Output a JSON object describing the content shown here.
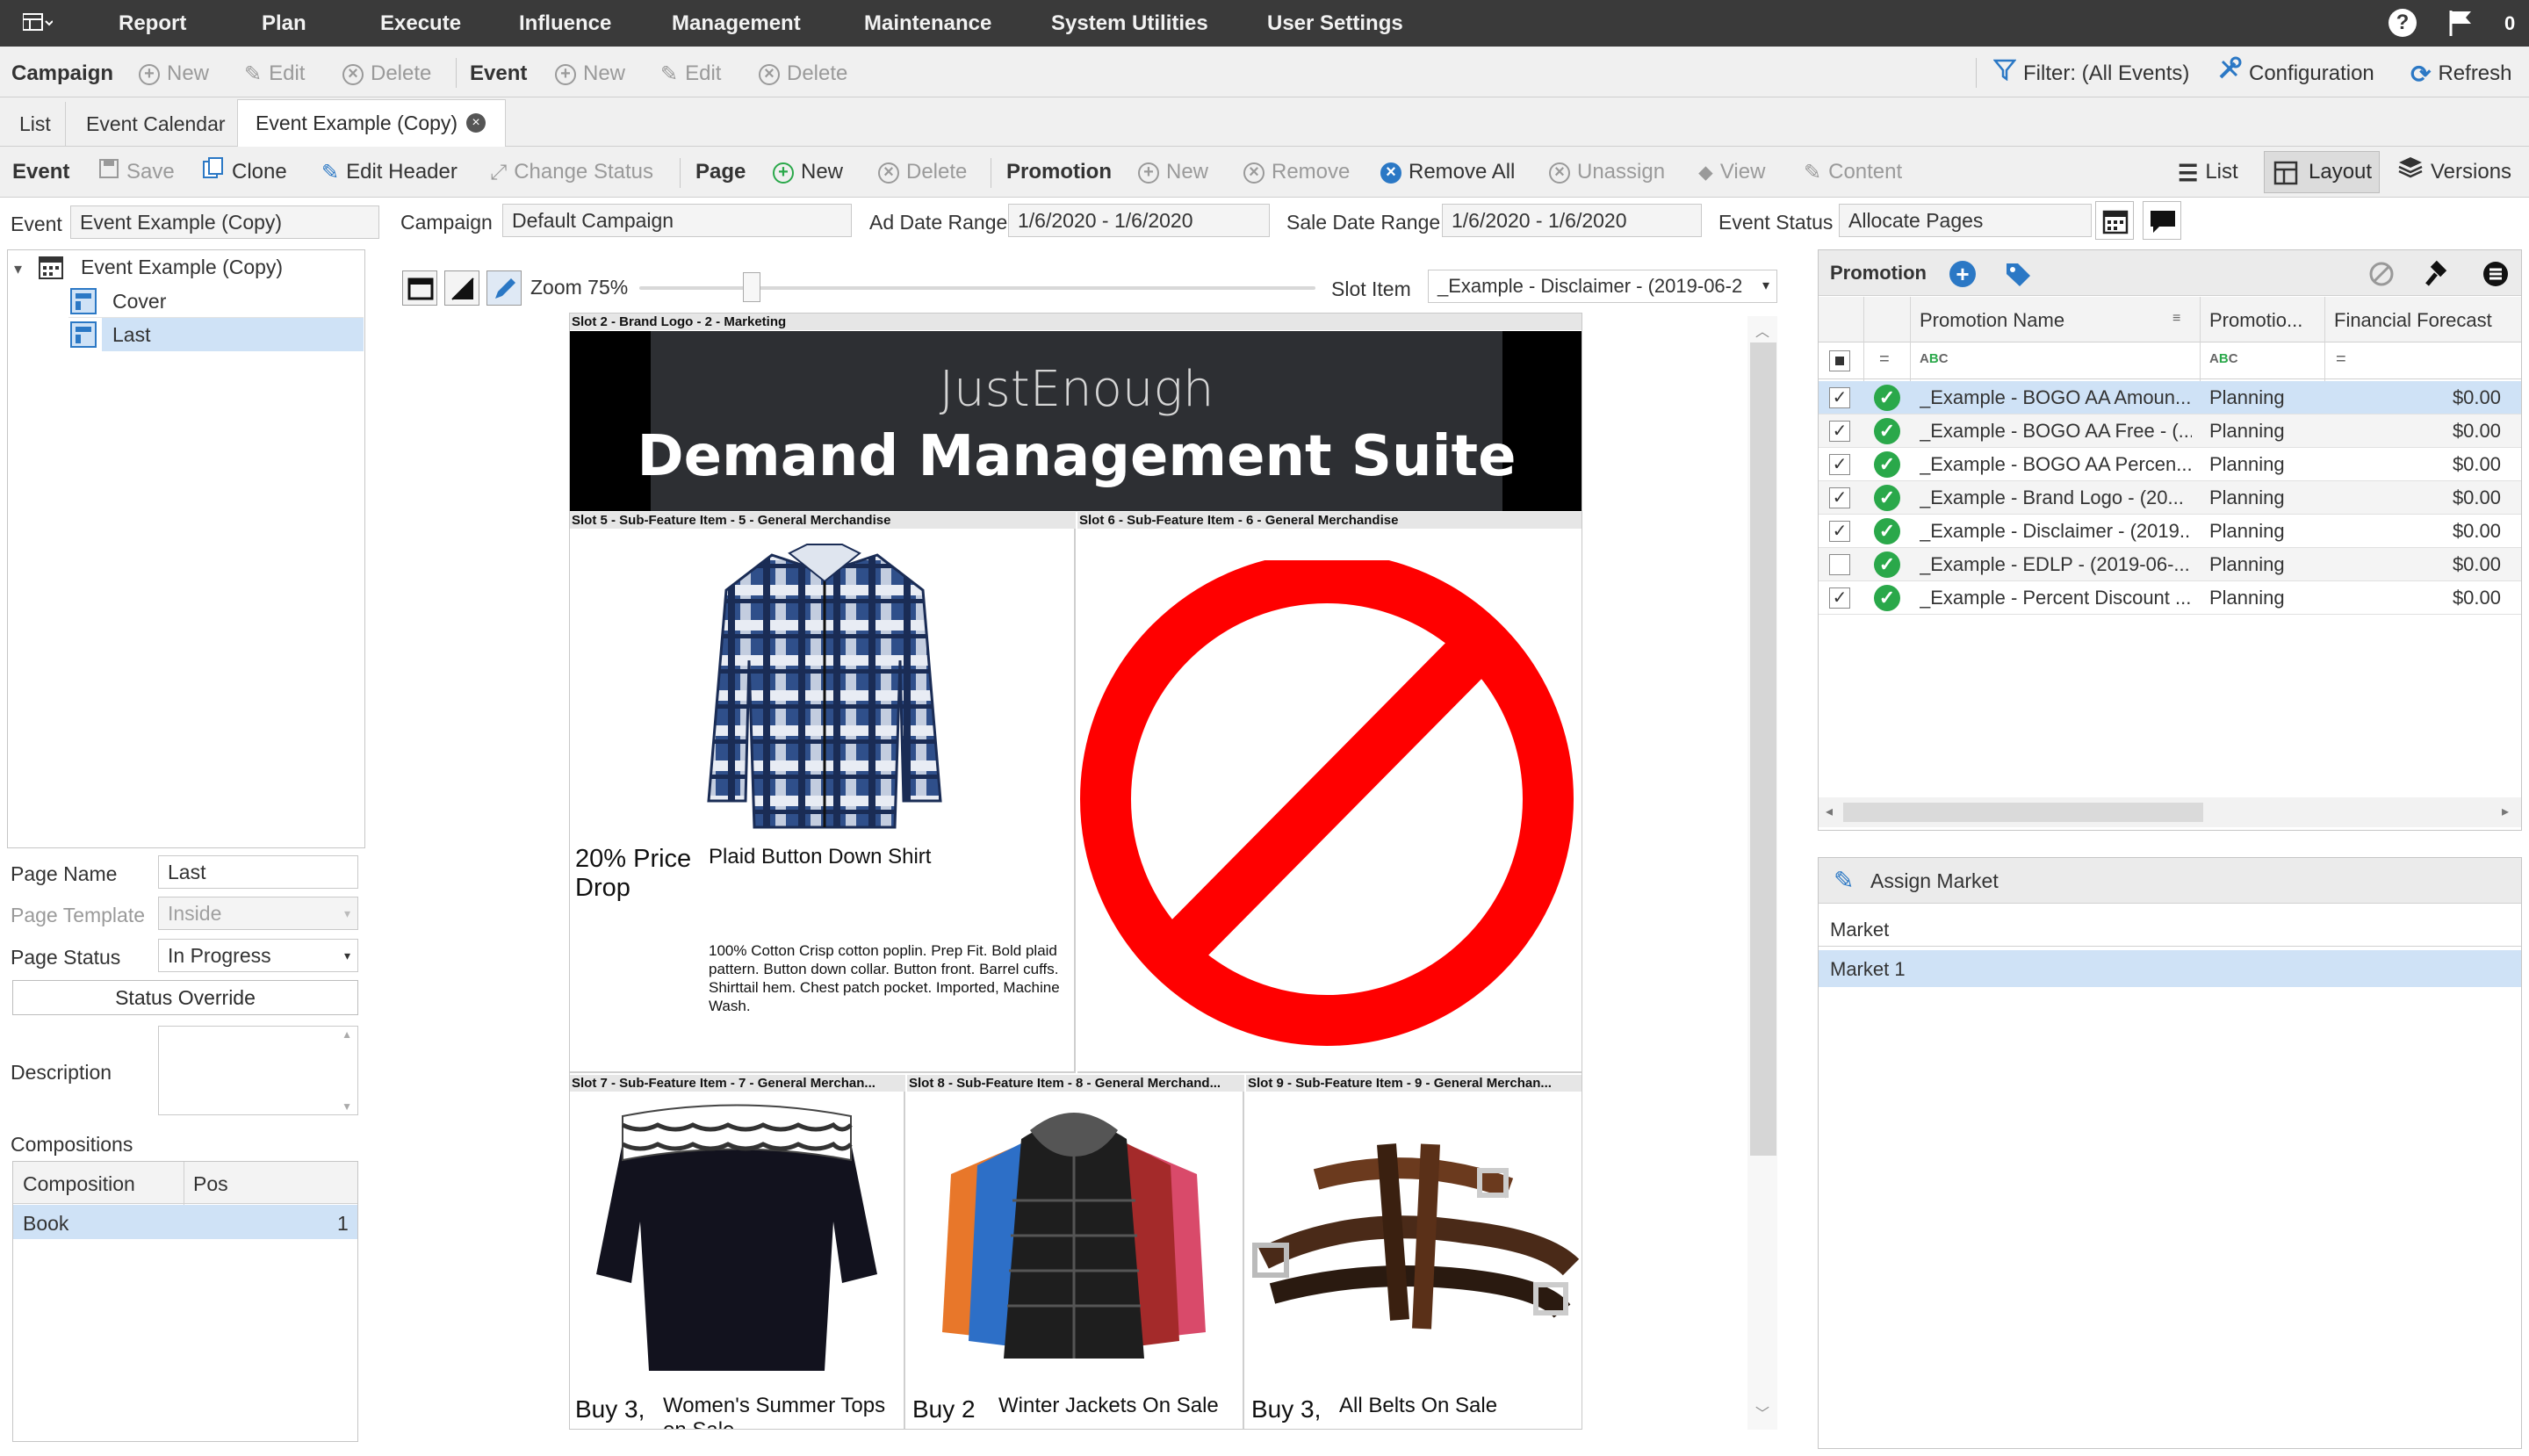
{
  "menu": {
    "items": [
      "Report",
      "Plan",
      "Execute",
      "Influence",
      "Management",
      "Maintenance",
      "System Utilities",
      "User Settings"
    ],
    "notif_count": "0"
  },
  "toolbar1": {
    "campaign": "Campaign",
    "new": "New",
    "edit": "Edit",
    "delete": "Delete",
    "event": "Event",
    "new2": "New",
    "edit2": "Edit",
    "delete2": "Delete",
    "filter": "Filter: (All Events)",
    "configuration": "Configuration",
    "refresh": "Refresh"
  },
  "tabs": [
    "List",
    "Event Calendar",
    "Event Example (Copy)"
  ],
  "toolbar2": {
    "event": "Event",
    "save": "Save",
    "clone": "Clone",
    "edit_header": "Edit Header",
    "change_status": "Change Status",
    "page": "Page",
    "new": "New",
    "delete": "Delete",
    "promotion": "Promotion",
    "new2": "New",
    "remove": "Remove",
    "remove_all": "Remove All",
    "unassign": "Unassign",
    "view": "View",
    "content": "Content",
    "list": "List",
    "layout": "Layout",
    "versions": "Versions"
  },
  "header": {
    "event_label": "Event",
    "event_value": "Event Example (Copy)",
    "campaign_label": "Campaign",
    "campaign_value": "Default Campaign",
    "ad_date_label": "Ad Date Range",
    "ad_date_value": "1/6/2020 - 1/6/2020",
    "sale_date_label": "Sale Date Range",
    "sale_date_value": "1/6/2020 - 1/6/2020",
    "status_label": "Event Status",
    "status_value": "Allocate Pages"
  },
  "tree": {
    "root": "Event Example (Copy)",
    "children": [
      "Cover",
      "Last"
    ]
  },
  "page_props": {
    "page_name_label": "Page Name",
    "page_name": "Last",
    "template_label": "Page Template",
    "template": "Inside",
    "status_label": "Page Status",
    "status": "In Progress",
    "status_override": "Status Override",
    "description_label": "Description",
    "compositions_label": "Compositions",
    "col_composition": "Composition",
    "col_pos": "Pos",
    "comp_name": "Book",
    "comp_pos": "1"
  },
  "layout": {
    "zoom": "Zoom 75%",
    "slot_item_label": "Slot Item",
    "slot_item_value": "_Example - Disclaimer - (2019-06-2"
  },
  "slots": {
    "s2": "Slot 2 - Brand Logo - 2 - Marketing",
    "banner_small": "JustEnough",
    "banner_big": "Demand Management Suite",
    "s5": "Slot 5 - Sub-Feature Item - 5 - General Merchandise",
    "s5_price": "20% Price Drop",
    "s5_title": "Plaid Button Down Shirt",
    "s5_desc": "100% Cotton Crisp cotton poplin. Prep Fit. Bold plaid pattern. Button down collar. Button front. Barrel cuffs. Shirttail hem. Chest patch pocket. Imported, Machine Wash.",
    "s6": "Slot 6 - Sub-Feature Item - 6 - General Merchandise",
    "s7": "Slot 7 - Sub-Feature Item - 7 - General Merchan...",
    "s7_price": "Buy 3,",
    "s7_title": "Women's Summer Tops on Sale",
    "s8": "Slot 8 - Sub-Feature Item - 8 - General Merchand...",
    "s8_price": "Buy 2",
    "s8_title": "Winter Jackets On Sale",
    "s9": "Slot 9 - Sub-Feature Item - 9 - General Merchan...",
    "s9_price": "Buy 3,",
    "s9_title": "All Belts On Sale"
  },
  "promotion": {
    "title": "Promotion",
    "col_name": "Promotion Name",
    "col_status": "Promotio...",
    "col_forecast": "Financial Forecast",
    "rows": [
      {
        "name": "_Example - BOGO AA Amoun...",
        "status": "Planning",
        "forecast": "$0.00",
        "checked": true
      },
      {
        "name": "_Example - BOGO AA Free - (...",
        "status": "Planning",
        "forecast": "$0.00",
        "checked": true
      },
      {
        "name": "_Example - BOGO AA Percen...",
        "status": "Planning",
        "forecast": "$0.00",
        "checked": true
      },
      {
        "name": "_Example - Brand Logo - (20...",
        "status": "Planning",
        "forecast": "$0.00",
        "checked": true
      },
      {
        "name": "_Example - Disclaimer - (2019...",
        "status": "Planning",
        "forecast": "$0.00",
        "checked": true
      },
      {
        "name": "_Example - EDLP - (2019-06-...",
        "status": "Planning",
        "forecast": "$0.00",
        "checked": false
      },
      {
        "name": "_Example - Percent Discount ...",
        "status": "Planning",
        "forecast": "$0.00",
        "checked": true
      }
    ]
  },
  "market": {
    "title": "Assign Market",
    "col": "Market",
    "row": "Market 1"
  },
  "colors": {
    "accent": "#2b78c5",
    "selected": "#cfe2f6",
    "green": "#2aa84a",
    "topbar": "#3a3a3a"
  }
}
